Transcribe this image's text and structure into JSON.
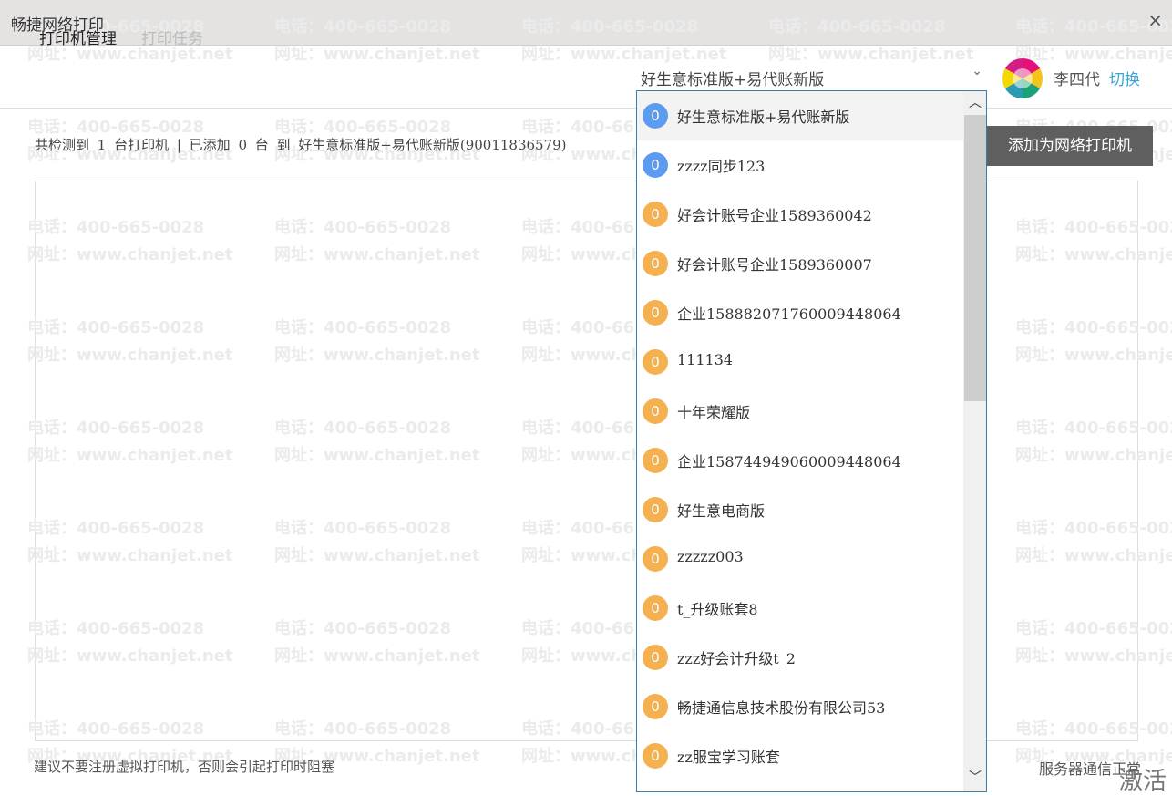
{
  "window": {
    "title": "畅捷网络打印",
    "close_icon": "×"
  },
  "watermark": {
    "phone": "电话：400-665-0028",
    "url": "网址：www.chanjet.net"
  },
  "tabs": [
    {
      "label": "打印机管理",
      "active": true
    },
    {
      "label": "打印任务",
      "active": false
    }
  ],
  "info": "共检测到 1 台打印机 | 已添加 0 台 到 好生意标准版+易代账新版(90011836579)",
  "add_button": "添加为网络打印机",
  "user": {
    "name": "李四代",
    "switch_label": "切换"
  },
  "account_select": {
    "value": "好生意标准版+易代账新版",
    "chevron": "⌄"
  },
  "colors": {
    "badge_blue": "#5b9cf0",
    "badge_orange": "#f5b04f",
    "link": "#3aa3d8"
  },
  "accounts": [
    {
      "label": "好生意标准版+易代账新版",
      "count": "0",
      "color": "blue",
      "selected": true
    },
    {
      "label": "zzzz同步123",
      "count": "0",
      "color": "blue"
    },
    {
      "label": "好会计账号企业1589360042",
      "count": "0",
      "color": "orange"
    },
    {
      "label": "好会计账号企业1589360007",
      "count": "0",
      "color": "orange"
    },
    {
      "label": "企业15888207176000944806​4",
      "count": "0",
      "color": "orange"
    },
    {
      "label": "111134",
      "count": "0",
      "color": "orange"
    },
    {
      "label": "十年荣耀版",
      "count": "0",
      "color": "orange"
    },
    {
      "label": "企业158744949060009448064",
      "count": "0",
      "color": "orange"
    },
    {
      "label": "好生意电商版",
      "count": "0",
      "color": "orange"
    },
    {
      "label": "zzzzz003",
      "count": "0",
      "color": "orange"
    },
    {
      "label": "t_升级账套8",
      "count": "0",
      "color": "orange"
    },
    {
      "label": "zzz好会计升级t_2",
      "count": "0",
      "color": "orange"
    },
    {
      "label": "畅捷通信息技术股份有限公司53",
      "count": "0",
      "color": "orange"
    },
    {
      "label": "zz服宝学习账套",
      "count": "0",
      "color": "orange"
    }
  ],
  "footer": {
    "hint": "建议不要注册虚拟打印机，否则会引起打印时阻塞",
    "status": "服务器通信正常",
    "activation": "激活"
  }
}
